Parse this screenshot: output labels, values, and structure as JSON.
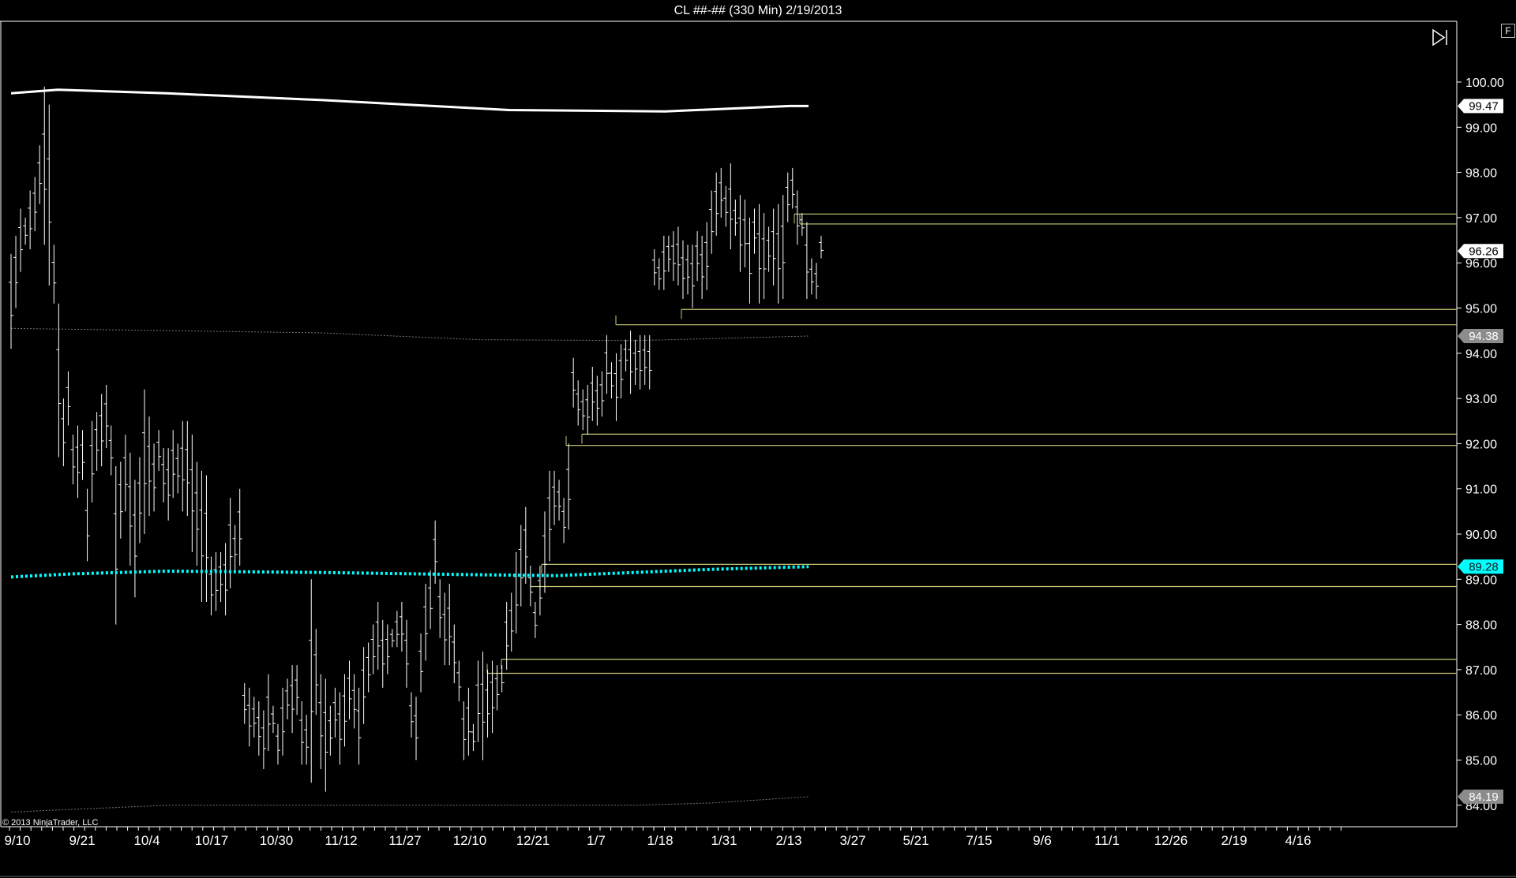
{
  "window": {
    "title": "CL ##-## (330 Min)  2/19/2013",
    "f_button": "F",
    "copyright": "© 2013 NinjaTrader, LLC"
  },
  "chart_data": {
    "type": "ohlc",
    "title": "CL ##-## (330 Min)  2/19/2013",
    "ylim": [
      83.85,
      101.3
    ],
    "y_ticks": [
      "84.00",
      "85.00",
      "86.00",
      "87.00",
      "88.00",
      "89.00",
      "90.00",
      "91.00",
      "92.00",
      "93.00",
      "94.00",
      "95.00",
      "96.00",
      "97.00",
      "98.00",
      "99.00",
      "100.00"
    ],
    "x_labels": [
      "9/10",
      "9/21",
      "10/4",
      "10/17",
      "10/30",
      "11/12",
      "11/27",
      "12/10",
      "12/21",
      "1/7",
      "1/18",
      "1/31",
      "2/13",
      "3/27",
      "5/21",
      "7/15",
      "9/6",
      "11/1",
      "12/26",
      "2/19",
      "4/16"
    ],
    "price_markers": [
      {
        "label": "99.47",
        "value": 99.47,
        "bg": "#ffffff",
        "fg": "#000000"
      },
      {
        "label": "96.26",
        "value": 96.26,
        "bg": "#ffffff",
        "fg": "#000000"
      },
      {
        "label": "94.38",
        "value": 94.38,
        "bg": "#8c8c8c",
        "fg": "#ffffff"
      },
      {
        "label": "89.28",
        "value": 89.28,
        "bg": "#00ffff",
        "fg": "#1a1a1a"
      },
      {
        "label": "84.19",
        "value": 84.19,
        "bg": "#8c8c8c",
        "fg": "#ffffff"
      }
    ],
    "horizontal_levels": [
      97.08,
      96.86,
      94.97,
      94.63,
      92.21,
      91.96,
      89.33,
      88.84,
      87.23,
      86.92
    ],
    "series": [
      {
        "name": "upper-band",
        "color": "#ffffff",
        "points": [
          [
            0,
            99.75
          ],
          [
            60,
            99.83
          ],
          [
            200,
            99.75
          ],
          [
            400,
            99.6
          ],
          [
            640,
            99.38
          ],
          [
            840,
            99.35
          ],
          [
            1000,
            99.47
          ],
          [
            1024,
            99.47
          ]
        ]
      },
      {
        "name": "middle-ma",
        "color": "#00ffff",
        "points": [
          [
            0,
            89.05
          ],
          [
            80,
            89.12
          ],
          [
            200,
            89.18
          ],
          [
            400,
            89.15
          ],
          [
            600,
            89.1
          ],
          [
            700,
            89.08
          ],
          [
            800,
            89.15
          ],
          [
            900,
            89.22
          ],
          [
            1024,
            89.28
          ]
        ]
      },
      {
        "name": "upper-dotted",
        "color": "#777777",
        "points": [
          [
            0,
            94.55
          ],
          [
            200,
            94.5
          ],
          [
            400,
            94.45
          ],
          [
            600,
            94.3
          ],
          [
            800,
            94.28
          ],
          [
            1024,
            94.38
          ]
        ]
      },
      {
        "name": "lower-dotted",
        "color": "#777777",
        "points": [
          [
            0,
            83.85
          ],
          [
            200,
            84.0
          ],
          [
            400,
            84.0
          ],
          [
            600,
            84.0
          ],
          [
            800,
            84.0
          ],
          [
            900,
            84.05
          ],
          [
            1024,
            84.19
          ]
        ]
      }
    ],
    "colors": {
      "bars": "#ffffff",
      "levels": "#c8c87a",
      "background": "#000000",
      "axis": "#ffffff"
    }
  }
}
